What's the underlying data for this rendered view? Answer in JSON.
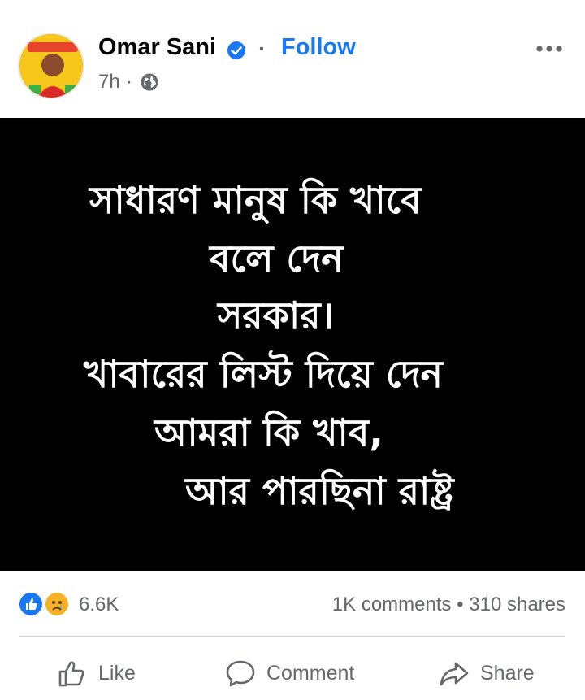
{
  "post": {
    "author": "Omar Sani",
    "follow_label": "Follow",
    "separator": "·",
    "time": "7h",
    "time_separator": "·",
    "body_lines": [
      "সাধারণ মানুষ কি খাবে",
      "বলে দেন",
      "সরকার।",
      "খাবারের লিস্ট দিয়ে দেন",
      "আমরা কি খাব,",
      "আর পারছিনা রাষ্ট্র"
    ],
    "background_color": "#000000",
    "text_color": "#ffffff"
  },
  "stats": {
    "reaction_count": "6.6K",
    "comments_shares": "1K comments • 310 shares"
  },
  "actions": {
    "like": "Like",
    "comment": "Comment",
    "share": "Share"
  },
  "icons": {
    "verified": "verified-badge-icon",
    "privacy": "globe-icon",
    "more": "more-options-icon",
    "reactions": [
      "like-reaction-icon",
      "sad-reaction-icon"
    ],
    "like": "thumbs-up-icon",
    "comment": "comment-bubble-icon",
    "share": "share-arrow-icon"
  },
  "colors": {
    "accent": "#1877f2",
    "secondary_text": "#65676b"
  }
}
